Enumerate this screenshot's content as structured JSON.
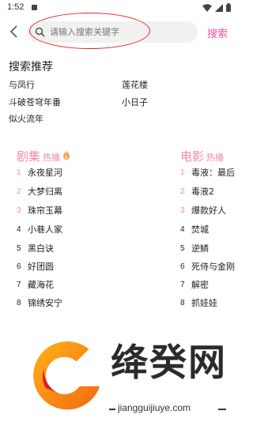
{
  "status_bar": {
    "time": "1:52"
  },
  "search": {
    "placeholder": "请输入搜索关键字",
    "button_label": "搜索"
  },
  "recommend": {
    "title": "搜索推荐",
    "items": [
      "与凤行",
      "莲花楼",
      "斗破苍穹年番",
      "小日子",
      "似火流年"
    ]
  },
  "series": {
    "heading": "剧集",
    "sub": "热播",
    "items": [
      {
        "rank": "1",
        "title": "永夜星河"
      },
      {
        "rank": "2",
        "title": "大梦归离"
      },
      {
        "rank": "3",
        "title": "珠帘玉幕"
      },
      {
        "rank": "4",
        "title": "小巷人家"
      },
      {
        "rank": "5",
        "title": "黑白诀"
      },
      {
        "rank": "6",
        "title": "好团圆"
      },
      {
        "rank": "7",
        "title": "藏海花"
      },
      {
        "rank": "8",
        "title": "锦绣安宁"
      }
    ]
  },
  "movies": {
    "heading": "电影",
    "sub": "热播",
    "items": [
      {
        "rank": "1",
        "title": "毒液：最后"
      },
      {
        "rank": "2",
        "title": "毒液2"
      },
      {
        "rank": "3",
        "title": "爆款好人"
      },
      {
        "rank": "4",
        "title": "焚城"
      },
      {
        "rank": "5",
        "title": "逆鳞"
      },
      {
        "rank": "6",
        "title": "死侍与金刚"
      },
      {
        "rank": "7",
        "title": "解密"
      },
      {
        "rank": "8",
        "title": "抓娃娃"
      }
    ]
  },
  "watermark": {
    "title": "绛癸网",
    "url": "jiangguijiuye.com"
  },
  "colors": {
    "accent": "#f0559a",
    "rank_top": "#f08ab0",
    "highlight": "#e02626"
  }
}
